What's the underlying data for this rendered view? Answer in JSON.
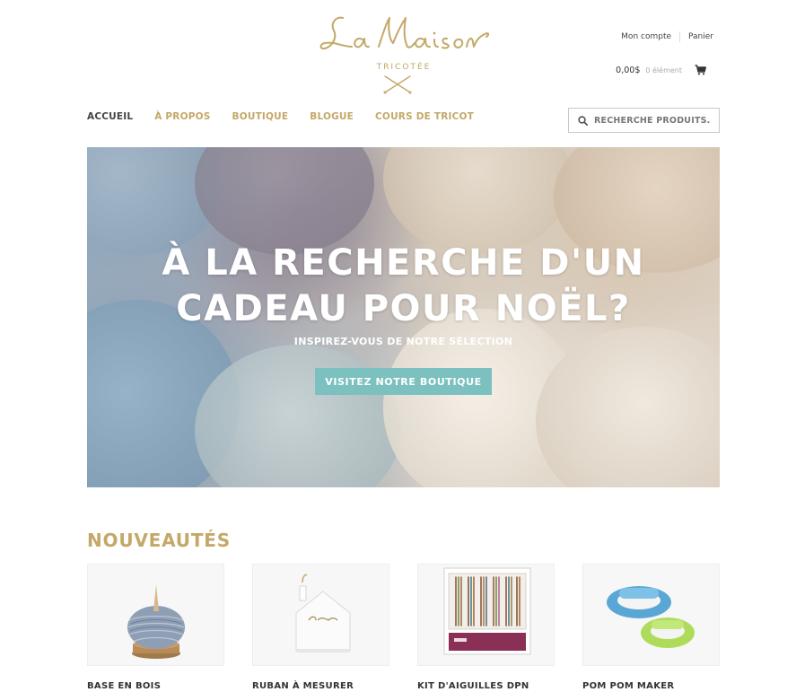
{
  "logo": {
    "script": "La Maison",
    "subtitle": "TRICOTÉE"
  },
  "account": {
    "my_account": "Mon compte",
    "cart_link": "Panier"
  },
  "cart": {
    "amount": "0,00$",
    "items": "0 élément",
    "icon": "shopping-cart-icon"
  },
  "nav": {
    "items": [
      {
        "label": "ACCUEIL",
        "active": true
      },
      {
        "label": "À PROPOS",
        "active": false
      },
      {
        "label": "BOUTIQUE",
        "active": false
      },
      {
        "label": "BLOGUE",
        "active": false
      },
      {
        "label": "COURS DE TRICOT",
        "active": false
      }
    ]
  },
  "search": {
    "placeholder": "RECHERCHE PRODUITS...",
    "icon": "search-icon"
  },
  "hero": {
    "title_line1": "À LA RECHERCHE D'UN",
    "title_line2": "CADEAU POUR NOËL?",
    "subtitle": "INSPIREZ-VOUS DE NOTRE SÉLECTION",
    "button": "VISITEZ NOTRE BOUTIQUE"
  },
  "new_products": {
    "title": "NOUVEAUTÉS",
    "items": [
      {
        "name": "BASE EN BOIS"
      },
      {
        "name": "RUBAN À MESURER"
      },
      {
        "name": "KIT D'AIGUILLES DPN"
      },
      {
        "name": "POM POM MAKER"
      }
    ]
  },
  "colors": {
    "brand_gold": "#c3a867",
    "button_teal": "#7cc0c0",
    "nav_active": "#444444"
  }
}
